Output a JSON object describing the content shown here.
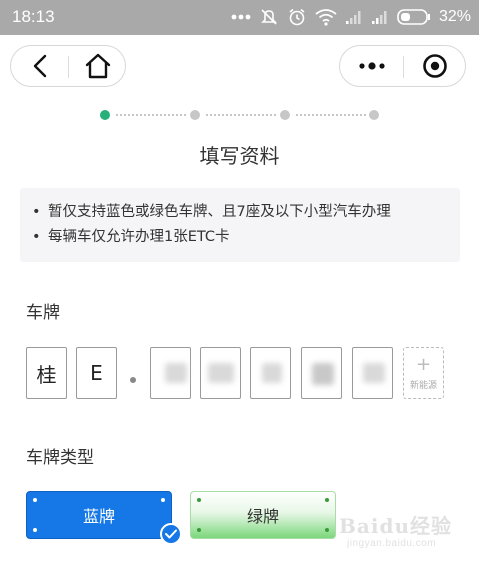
{
  "status_bar": {
    "time": "18:13",
    "battery_pct": "32%"
  },
  "nav": {
    "back_icon": "chevron-left-icon",
    "home_icon": "home-icon",
    "more_icon": "more-dots-icon",
    "close_icon": "target-circle-icon"
  },
  "steps": {
    "total": 4,
    "current": 1,
    "active_color": "#27b07a"
  },
  "page_title": "填写资料",
  "notice": {
    "items": [
      "暂仅支持蓝色或绿色车牌、且7座及以下小型汽车办理",
      "每辆车仅允许办理1张ETC卡"
    ]
  },
  "plate": {
    "label": "车牌",
    "chars": [
      "桂",
      "E",
      "",
      "",
      "",
      "",
      ""
    ],
    "new_energy_plus": "+",
    "new_energy_label": "新能源"
  },
  "plate_type": {
    "label": "车牌类型",
    "options": [
      {
        "label": "蓝牌",
        "selected": true,
        "color": "#1678e6"
      },
      {
        "label": "绿牌",
        "selected": false,
        "color": "#7cd77c"
      }
    ]
  },
  "watermark": {
    "text": "Baidu经验",
    "sub": "jingyan.baidu.com"
  }
}
